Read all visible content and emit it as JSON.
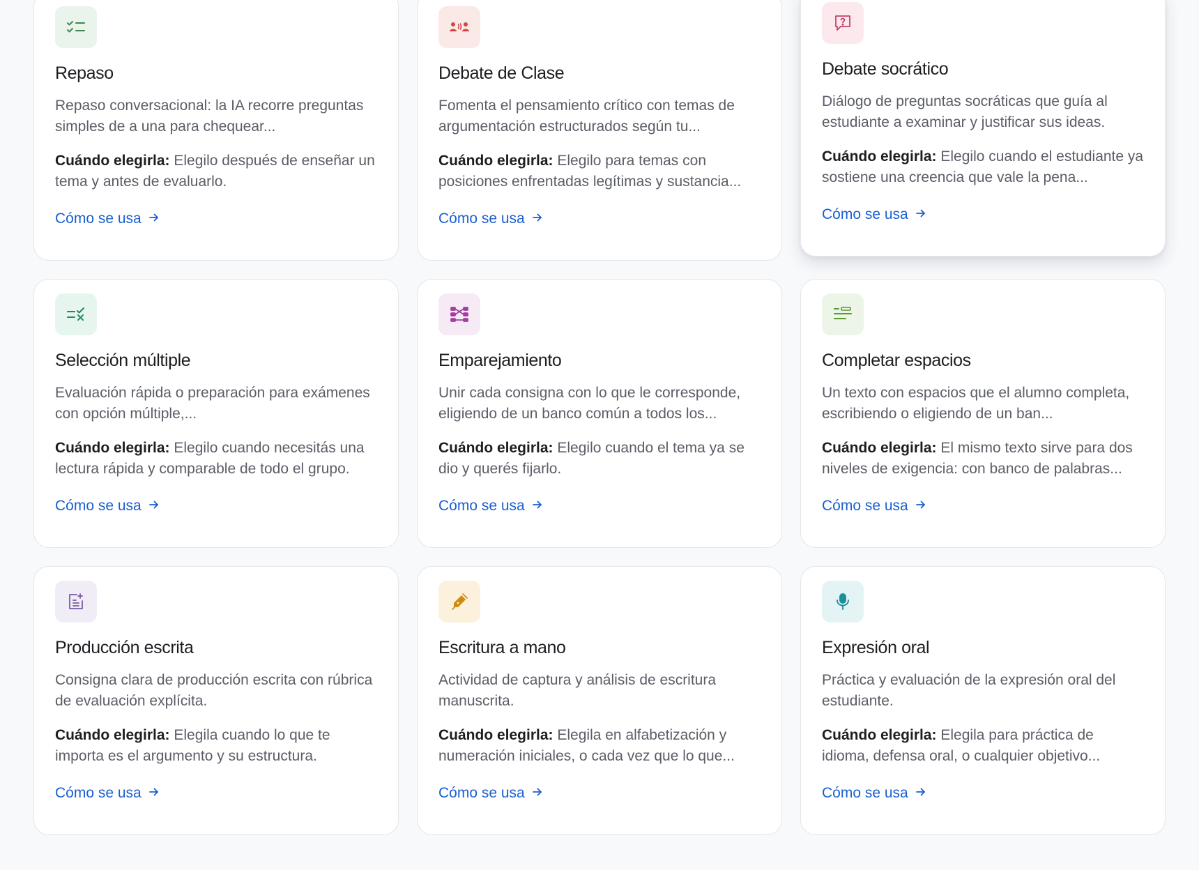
{
  "link_label": "Cómo se usa",
  "when_label": "Cuándo elegirla:",
  "cards": [
    {
      "title": "Repaso",
      "description": "Repaso conversacional: la IA recorre preguntas simples de a una para chequear...",
      "when": "Elegilo después de enseñar un tema y antes de evaluarlo.",
      "icon": "checklist-icon",
      "icon_bg": "#eaf3ec",
      "icon_color": "#3d8a4e"
    },
    {
      "title": "Debate de Clase",
      "description": "Fomenta el pensamiento crítico con temas de argumentación estructurados según tu...",
      "when": "Elegilo para temas con posiciones enfrentadas legítimas y sustancia...",
      "icon": "debate-people-icon",
      "icon_bg": "#fbe9e8",
      "icon_color": "#d2463f"
    },
    {
      "title": "Debate socrático",
      "description": "Diálogo de preguntas socráticas que guía al estudiante a examinar y justificar sus ideas.",
      "when": "Elegilo cuando el estudiante ya sostiene una creencia que vale la pena...",
      "icon": "question-bubble-icon",
      "icon_bg": "#fbe9ee",
      "icon_color": "#c2436a"
    },
    {
      "title": "Selección múltiple",
      "description": "Evaluación rápida o preparación para exámenes con opción múltiple,...",
      "when": "Elegilo cuando necesitás una lectura rápida y comparable de todo el grupo.",
      "icon": "multiple-choice-icon",
      "icon_bg": "#e6f5ee",
      "icon_color": "#1f8a5b"
    },
    {
      "title": "Emparejamiento",
      "description": "Unir cada consigna con lo que le corresponde, eligiendo de un banco común a todos los...",
      "when": "Elegilo cuando el tema ya se dio y querés fijarlo.",
      "icon": "matching-icon",
      "icon_bg": "#f6eaf5",
      "icon_color": "#a23fa0"
    },
    {
      "title": "Completar espacios",
      "description": "Un texto con espacios que el alumno completa, escribiendo o eligiendo de un ban...",
      "when": "El mismo texto sirve para dos niveles de exigencia: con banco de palabras...",
      "icon": "fill-blanks-icon",
      "icon_bg": "#edf5e8",
      "icon_color": "#5a9a2b"
    },
    {
      "title": "Producción escrita",
      "description": "Consigna clara de producción escrita con rúbrica de evaluación explícita.",
      "when": "Elegila cuando lo que te importa es el argumento y su estructura.",
      "icon": "document-edit-icon",
      "icon_bg": "#f1edf7",
      "icon_color": "#7a5aa8"
    },
    {
      "title": "Escritura a mano",
      "description": "Actividad de captura y análisis de escritura manuscrita.",
      "when": "Elegila en alfabetización y numeración iniciales, o cada vez que lo que...",
      "icon": "pen-icon",
      "icon_bg": "#fbf1dd",
      "icon_color": "#d08a10"
    },
    {
      "title": "Expresión oral",
      "description": "Práctica y evaluación de la expresión oral del estudiante.",
      "when": "Elegila para práctica de idioma, defensa oral, o cualquier objetivo...",
      "icon": "microphone-icon",
      "icon_bg": "#e4f4f5",
      "icon_color": "#1f8f9a"
    }
  ]
}
